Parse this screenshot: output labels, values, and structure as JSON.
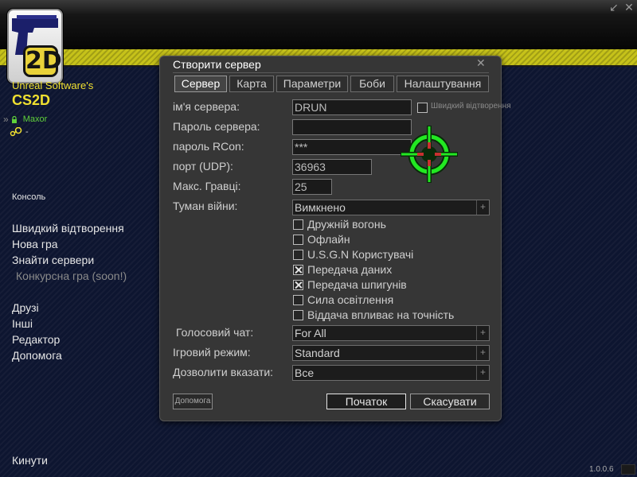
{
  "window": {
    "minimize_icon": "minimize-arrow-icon",
    "close_icon": "close-icon"
  },
  "brand": {
    "logo_text": "2D",
    "company": "Unreal Software's",
    "game": "CS2D"
  },
  "user": {
    "name": "Maxor",
    "steam_value": "-"
  },
  "menu": {
    "console": "Консоль",
    "quick_play": "Швидкий відтворення",
    "new_game": "Нова гра",
    "find_servers": "Знайти сервери",
    "contest": "Конкурсна гра (soon!)",
    "friends": "Друзі",
    "other": "Інші",
    "editor": "Редактор",
    "help": "Допомога",
    "quit": "Кинути"
  },
  "version": "1.0.0.6",
  "dialog": {
    "title": "Створити сервер",
    "tabs": [
      {
        "label": "Сервер",
        "active": true
      },
      {
        "label": "Карта",
        "active": false
      },
      {
        "label": "Параметри",
        "active": false
      },
      {
        "label": "Боби",
        "active": false
      },
      {
        "label": "Налаштування",
        "active": false
      }
    ],
    "labels": {
      "server_name": "ім'я сервера:",
      "server_password": "Пароль сервера:",
      "rcon_password": "пароль RCon:",
      "port": "порт (UDP):",
      "max_players": "Макс. Гравці:",
      "fog_of_war": "Туман війни:",
      "voice_chat": "Голосовий чат:",
      "game_mode": "Ігровий режим:",
      "allow_pointing": "Дозволити вказати:"
    },
    "fields": {
      "server_name": "DRUN",
      "server_password": "",
      "rcon_password": "***",
      "port": "36963",
      "max_players": "25"
    },
    "quick_play_checkbox": {
      "label": "Швидкий відтворення",
      "checked": false
    },
    "dropdowns": {
      "fog_of_war": "Вимкнено",
      "voice_chat": "For All",
      "game_mode": "Standard",
      "allow_pointing": "Все"
    },
    "checkboxes": [
      {
        "label": "Дружній вогонь",
        "checked": false
      },
      {
        "label": "Офлайн",
        "checked": false
      },
      {
        "label": "U.S.G.N Користувачі",
        "checked": false
      },
      {
        "label": "Передача даних",
        "checked": true
      },
      {
        "label": "Передача шпигунів",
        "checked": true
      },
      {
        "label": "Сила освітлення",
        "checked": false
      },
      {
        "label": "Віддача впливає на точність",
        "checked": false
      }
    ],
    "buttons": {
      "help": "Допомога",
      "start": "Початок",
      "cancel": "Скасувати"
    },
    "colors": {
      "crosshair": "#22e822",
      "accent_yellow": "#f0e030"
    }
  }
}
